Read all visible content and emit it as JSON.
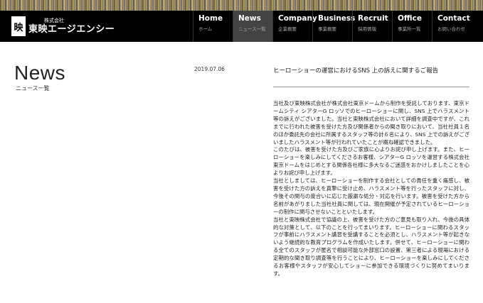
{
  "brand": {
    "logo_mark": "映",
    "company_sub": "株式会社",
    "company_name": "東映エージエンシー"
  },
  "nav": [
    {
      "label": "Home",
      "sub": "ホーム"
    },
    {
      "label": "News",
      "sub": "ニュース一覧"
    },
    {
      "label": "Company",
      "sub": "企業概要"
    },
    {
      "label": "Business",
      "sub": "事業概要"
    },
    {
      "label": "Recruit",
      "sub": "採用情報"
    },
    {
      "label": "Office",
      "sub": "事業所一覧"
    },
    {
      "label": "Contact",
      "sub": "お問い合わせ"
    }
  ],
  "page": {
    "title": "News",
    "subtitle": "ニュース一覧"
  },
  "post": {
    "date": "2019.07.06",
    "title": "ヒーローショーの運営におけるSNS 上の訴えに関するご報告",
    "paragraphs": [
      "当社及び東映株式会社が株式会社東京ドームから制作を受託しております、東京ドームシティ シアターG ロッソでのヒーローショーに関し、SNS 上でハラスメント等の訴えがございました。当社と東映株式会社において詳細を調査中ですが、これまでに行われた被害を受けた方及び関係者からの聞き取りにおいて、当社社員１名のほか委託先の会社に所属するスタッフ等の計６名により、SNS 上での訴えがございましたハラスメント等が行われていたことが概ね確認できました。",
      "このたびは、被害を受けた方及びご家族に心よりお詫び申し上げます。また、ヒーローショーを楽しみにしてくださるお客様、シアターG ロッソを運営する株式会社東京ドームをはじめとする関係各社様に多大なるご迷惑をおかけしましたことを心よりお詫び申し上げます。",
      "当社としましては、ヒーローショーを制作する会社としての責任を重く痛感し、被害を受けた方の訴えを真摯に受け止め、ハラスメント等を行ったスタッフに対し、今後その関与の度合いに応じた厳粛な処分・対応を行います。被害を受けた方から名前があがりました当社社員に関しては、現在開催が予定されているヒーローショーの制作に関与させないことといたします。",
      "当社と東映株式会社で協議の上、被害を受けた方のご意見も取り入れ、今後の具体的な対策として、以下のことを行ってまいります。ヒーローショーに関わるスタッフが事前にハラスメント講習を受講することを必須とし、ハラスメント等が起きないよう継続的な教育プログラムを作成いたします。併せて、ヒーローショーに関わる全てのスタッフが匿名で相談可能な外部窓口の設置、第三者による現場における定期的な聞き取り調査等を行うことにより、ヒーローショーを楽しみにしてくださるお客様やスタッフが安心してショーに参加できる環境づくりに努めてまいります。"
    ]
  }
}
